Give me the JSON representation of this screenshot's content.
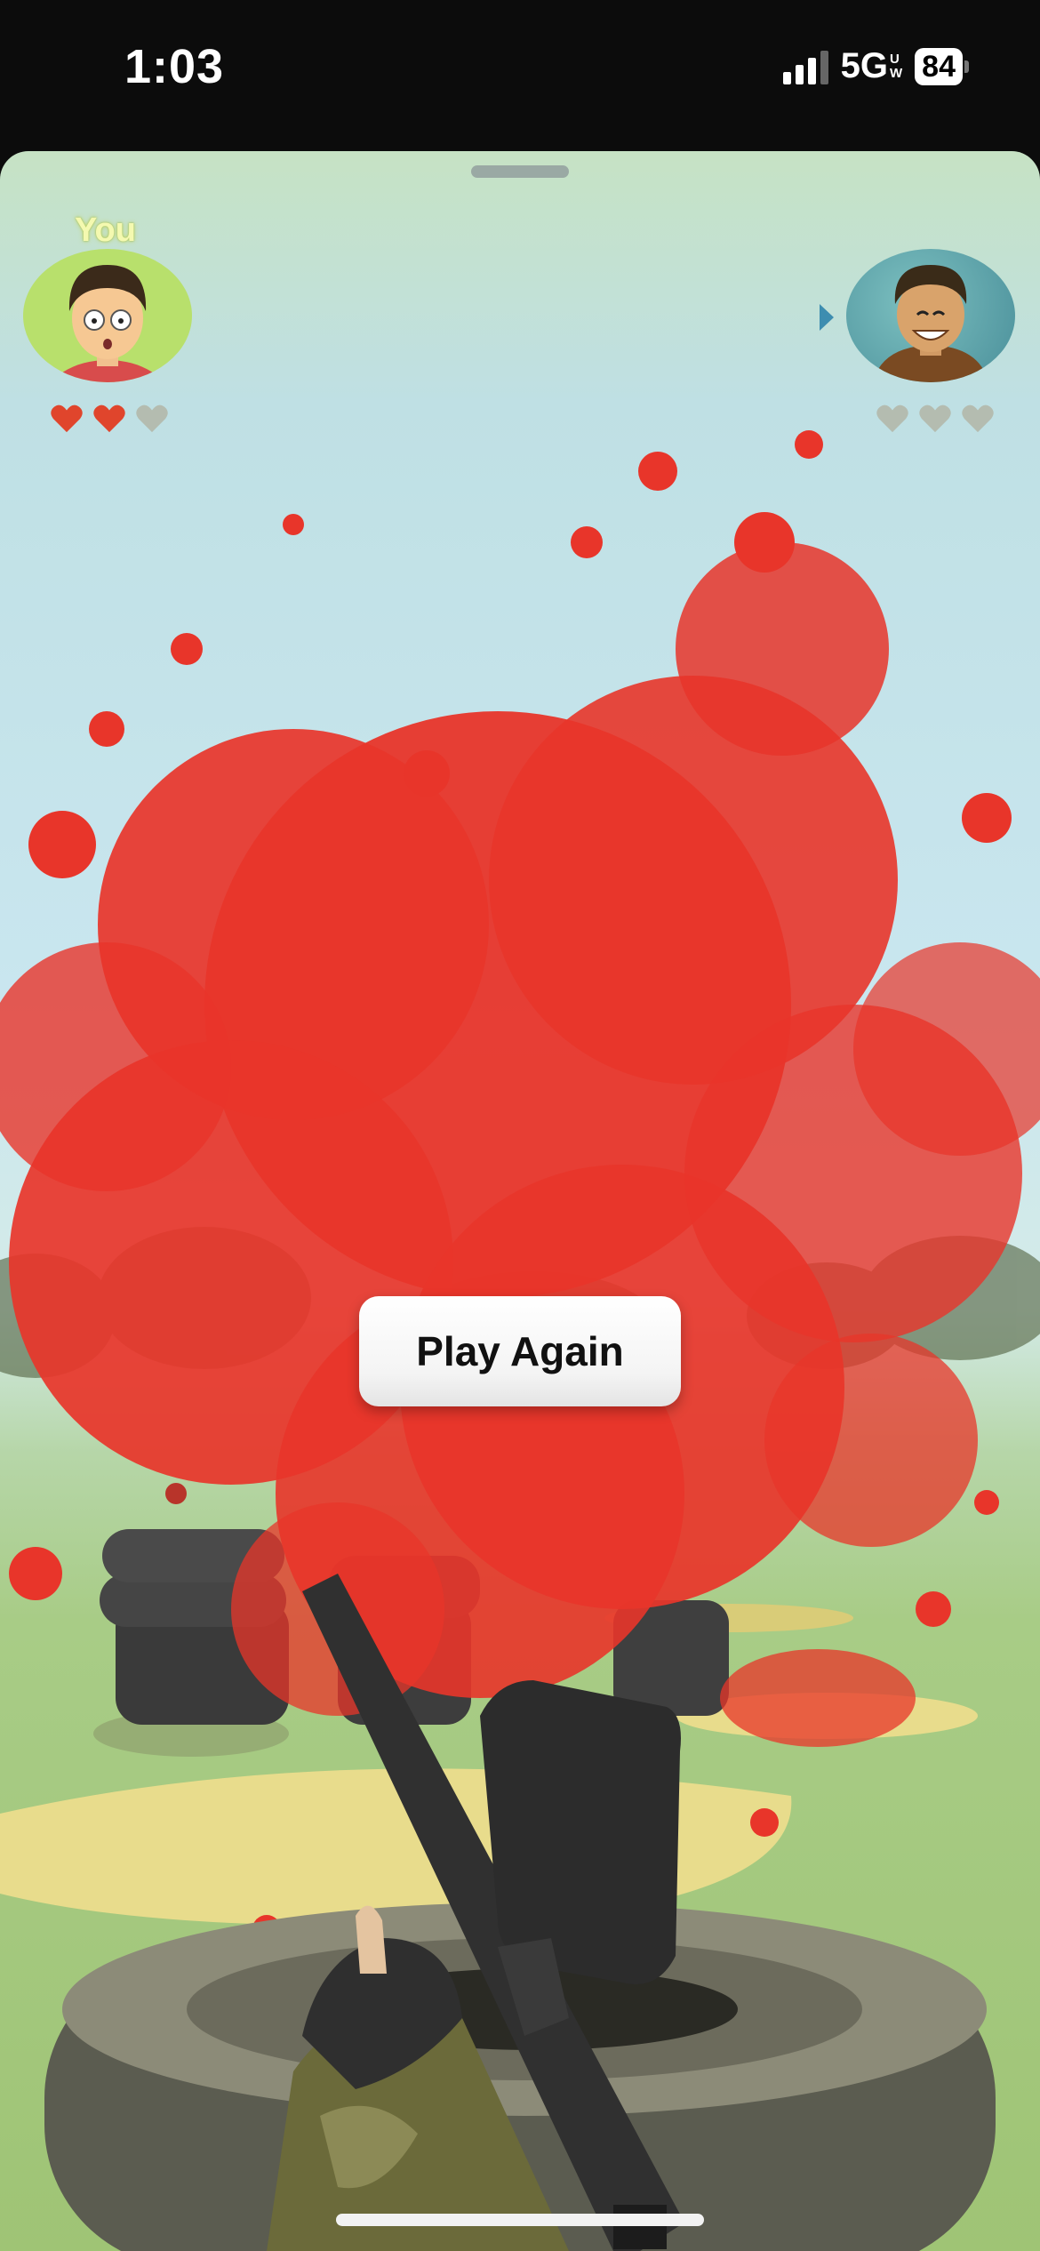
{
  "status_bar": {
    "time": "1:03",
    "network": "5G",
    "network_badge_top": "U",
    "network_badge_bottom": "W",
    "battery": "84"
  },
  "players": {
    "you_label": "You",
    "you_lives": 2,
    "you_max_lives": 3,
    "opponent_lives": 0,
    "opponent_max_lives": 3
  },
  "game": {
    "play_again_label": "Play Again"
  },
  "colors": {
    "heart_full": "#e0452c",
    "heart_empty": "#b4bcb0",
    "paint_splat": "#e8352a",
    "turn_indicator": "#3d8db0"
  }
}
